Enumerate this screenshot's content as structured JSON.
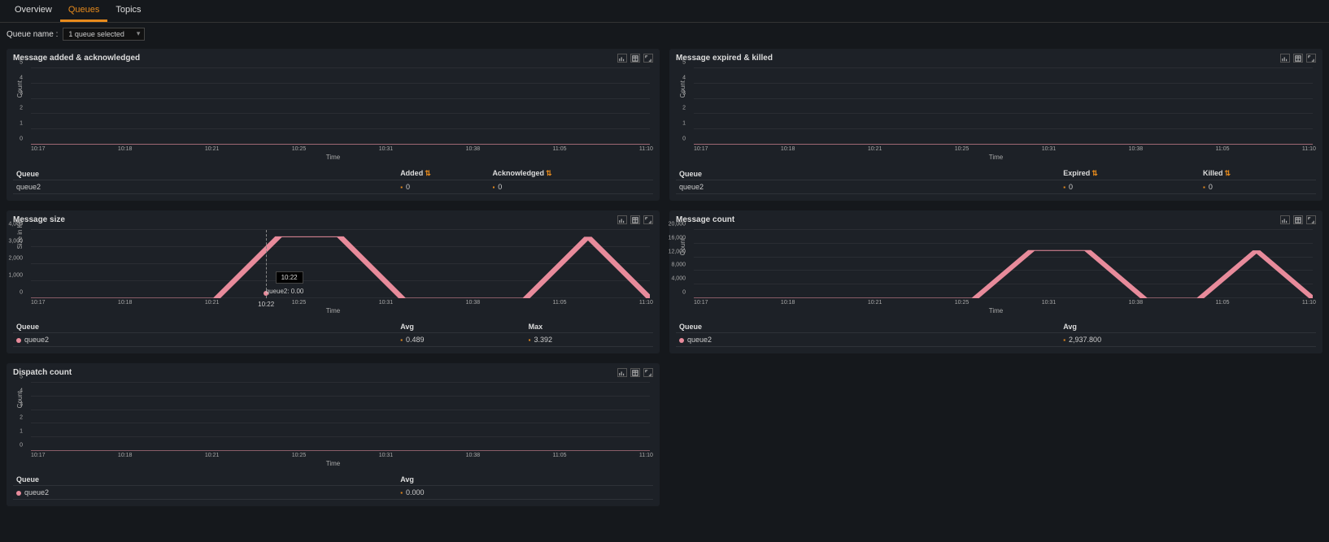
{
  "tabs": {
    "items": [
      "Overview",
      "Queues",
      "Topics"
    ],
    "active": 1
  },
  "filter": {
    "label": "Queue name :",
    "selected": "1 queue selected"
  },
  "common": {
    "xlabel": "Time",
    "x_ticks": [
      "10:17",
      "10:18",
      "10:21",
      "10:25",
      "10:31",
      "10:38",
      "11:05",
      "11:10"
    ]
  },
  "chart_data": [
    {
      "id": "message-added-ack",
      "title": "Message added & acknowledged",
      "type": "line",
      "ylabel": "Count",
      "ylim": [
        0,
        5
      ],
      "y_ticks": [
        "0",
        "1",
        "2",
        "3",
        "4",
        "5"
      ],
      "series": [
        {
          "name": "queue2 Added",
          "values": [
            0,
            0,
            0,
            0,
            0,
            0,
            0,
            0
          ]
        },
        {
          "name": "queue2 Acknowledged",
          "values": [
            0,
            0,
            0,
            0,
            0,
            0,
            0,
            0
          ]
        }
      ],
      "legend": {
        "cols": [
          "Queue",
          "Added",
          "Acknowledged"
        ],
        "sortable_cols": [
          1,
          2
        ],
        "rows": [
          {
            "queue": "queue2",
            "vals": [
              "0",
              "0"
            ]
          }
        ]
      }
    },
    {
      "id": "message-expired-killed",
      "title": "Message expired & killed",
      "type": "line",
      "ylabel": "Count",
      "ylim": [
        0,
        5
      ],
      "y_ticks": [
        "0",
        "1",
        "2",
        "3",
        "4",
        "5"
      ],
      "series": [
        {
          "name": "queue2 Expired",
          "values": [
            0,
            0,
            0,
            0,
            0,
            0,
            0,
            0
          ]
        },
        {
          "name": "queue2 Killed",
          "values": [
            0,
            0,
            0,
            0,
            0,
            0,
            0,
            0
          ]
        }
      ],
      "legend": {
        "cols": [
          "Queue",
          "Expired",
          "Killed"
        ],
        "sortable_cols": [
          1,
          2
        ],
        "rows": [
          {
            "queue": "queue2",
            "vals": [
              "0",
              "0"
            ]
          }
        ]
      }
    },
    {
      "id": "message-size",
      "title": "Message size",
      "type": "line",
      "ylabel": "Size in KB",
      "ylim": [
        0,
        4000
      ],
      "y_ticks": [
        "0",
        "1,000",
        "2,000",
        "3,000",
        "4,000"
      ],
      "series": [
        {
          "name": "queue2",
          "values": [
            0,
            0,
            0,
            0,
            3600,
            3600,
            0,
            0,
            0,
            3600,
            0
          ]
        }
      ],
      "legend": {
        "cols": [
          "Queue",
          "Avg",
          "Max"
        ],
        "sortable_cols": [],
        "rows": [
          {
            "queue": "queue2",
            "vals": [
              "0.489",
              "3.392"
            ],
            "series_marker": true
          }
        ]
      },
      "tooltip": {
        "x_index_pct": 38,
        "time": "10:22",
        "x_tick": "10:22",
        "label": "queue2: 0.00"
      }
    },
    {
      "id": "message-count",
      "title": "Message count",
      "type": "line",
      "ylabel": "Count",
      "ylim": [
        0,
        20000
      ],
      "y_ticks": [
        "0",
        "4,000",
        "8,000",
        "12,000",
        "16,000",
        "20,000"
      ],
      "series": [
        {
          "name": "queue2",
          "values": [
            0,
            0,
            0,
            0,
            0,
            0,
            14000,
            14000,
            0,
            0,
            14000,
            0
          ]
        }
      ],
      "legend": {
        "cols": [
          "Queue",
          "Avg"
        ],
        "sortable_cols": [],
        "rows": [
          {
            "queue": "queue2",
            "vals": [
              "2,937.800"
            ],
            "series_marker": true
          }
        ]
      }
    },
    {
      "id": "dispatch-count",
      "title": "Dispatch count",
      "type": "line",
      "ylabel": "Count",
      "ylim": [
        0,
        5
      ],
      "y_ticks": [
        "0",
        "1",
        "2",
        "3",
        "4",
        "5"
      ],
      "series": [
        {
          "name": "queue2",
          "values": [
            0,
            0,
            0,
            0,
            0,
            0,
            0,
            0
          ]
        }
      ],
      "legend": {
        "cols": [
          "Queue",
          "Avg"
        ],
        "sortable_cols": [],
        "rows": [
          {
            "queue": "queue2",
            "vals": [
              "0.000"
            ],
            "series_marker": true
          }
        ]
      }
    }
  ]
}
